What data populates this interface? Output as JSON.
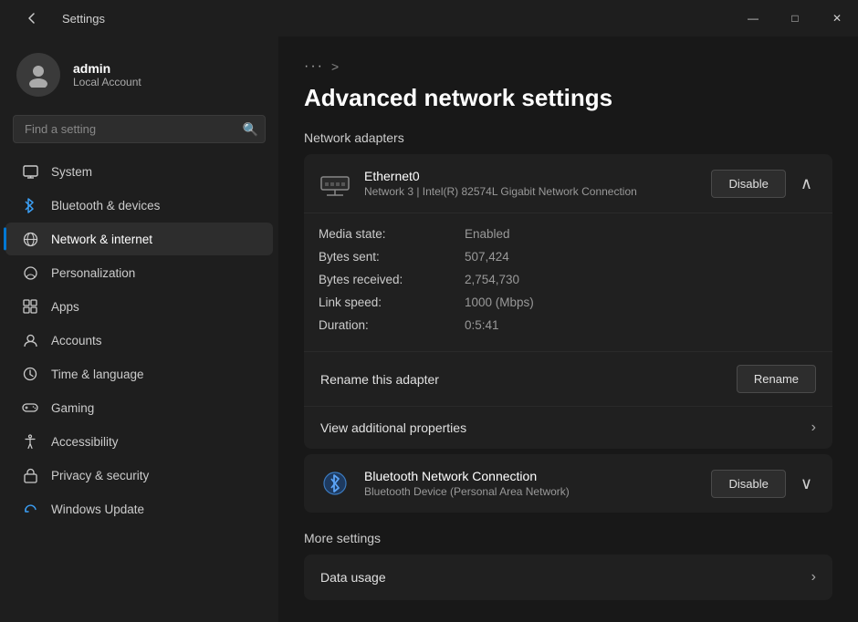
{
  "titlebar": {
    "back_icon": "←",
    "title": "Settings",
    "minimize": "—",
    "maximize": "□",
    "close": "✕"
  },
  "sidebar": {
    "user": {
      "name": "admin",
      "type": "Local Account"
    },
    "search": {
      "placeholder": "Find a setting"
    },
    "nav": [
      {
        "id": "system",
        "label": "System",
        "icon": "💻"
      },
      {
        "id": "bluetooth",
        "label": "Bluetooth & devices",
        "icon": "🔵"
      },
      {
        "id": "network",
        "label": "Network & internet",
        "icon": "🌐",
        "active": true
      },
      {
        "id": "personalization",
        "label": "Personalization",
        "icon": "🎨"
      },
      {
        "id": "apps",
        "label": "Apps",
        "icon": "📦"
      },
      {
        "id": "accounts",
        "label": "Accounts",
        "icon": "👤"
      },
      {
        "id": "time",
        "label": "Time & language",
        "icon": "🕐"
      },
      {
        "id": "gaming",
        "label": "Gaming",
        "icon": "🎮"
      },
      {
        "id": "accessibility",
        "label": "Accessibility",
        "icon": "♿"
      },
      {
        "id": "privacy",
        "label": "Privacy & security",
        "icon": "🔒"
      },
      {
        "id": "update",
        "label": "Windows Update",
        "icon": "🔄"
      }
    ]
  },
  "content": {
    "breadcrumb_dots": "···",
    "breadcrumb_arrow": ">",
    "page_title": "Advanced network settings",
    "section_network_adapters": "Network adapters",
    "adapters": [
      {
        "id": "ethernet0",
        "name": "Ethernet0",
        "description": "Network 3 | Intel(R) 82574L Gigabit Network Connection",
        "button_label": "Disable",
        "expanded": true,
        "stats": [
          {
            "label": "Media state:",
            "value": "Enabled"
          },
          {
            "label": "Bytes sent:",
            "value": "507,424"
          },
          {
            "label": "Bytes received:",
            "value": "2,754,730"
          },
          {
            "label": "Link speed:",
            "value": "1000 (Mbps)"
          },
          {
            "label": "Duration:",
            "value": "0:5:41"
          }
        ],
        "rename_label": "Rename this adapter",
        "rename_button": "Rename",
        "view_properties_label": "View additional properties"
      },
      {
        "id": "bluetooth-network",
        "name": "Bluetooth Network Connection",
        "description": "Bluetooth Device (Personal Area Network)",
        "button_label": "Disable",
        "expanded": false
      }
    ],
    "more_settings_title": "More settings",
    "more_settings": [
      {
        "id": "data-usage",
        "label": "Data usage"
      }
    ]
  }
}
